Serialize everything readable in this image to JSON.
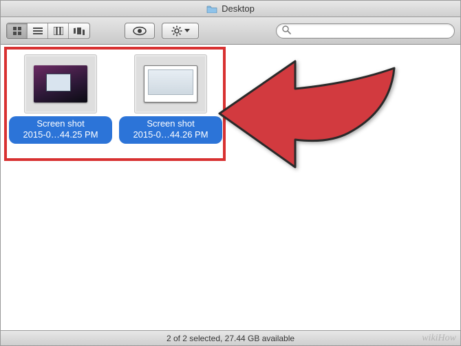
{
  "titlebar": {
    "title": "Desktop"
  },
  "toolbar": {
    "view_icon_name": "icon-view",
    "view_list_name": "list-view",
    "view_column_name": "column-view",
    "view_coverflow_name": "coverflow-view",
    "quicklook_name": "quicklook",
    "action_name": "action-menu"
  },
  "search": {
    "placeholder": ""
  },
  "files": [
    {
      "label_line1": "Screen shot",
      "label_line2": "2015-0…44.25 PM"
    },
    {
      "label_line1": "Screen shot",
      "label_line2": "2015-0…44.26 PM"
    }
  ],
  "statusbar": {
    "text": "2 of 2 selected, 27.44 GB available"
  },
  "watermark": "wikiHow"
}
